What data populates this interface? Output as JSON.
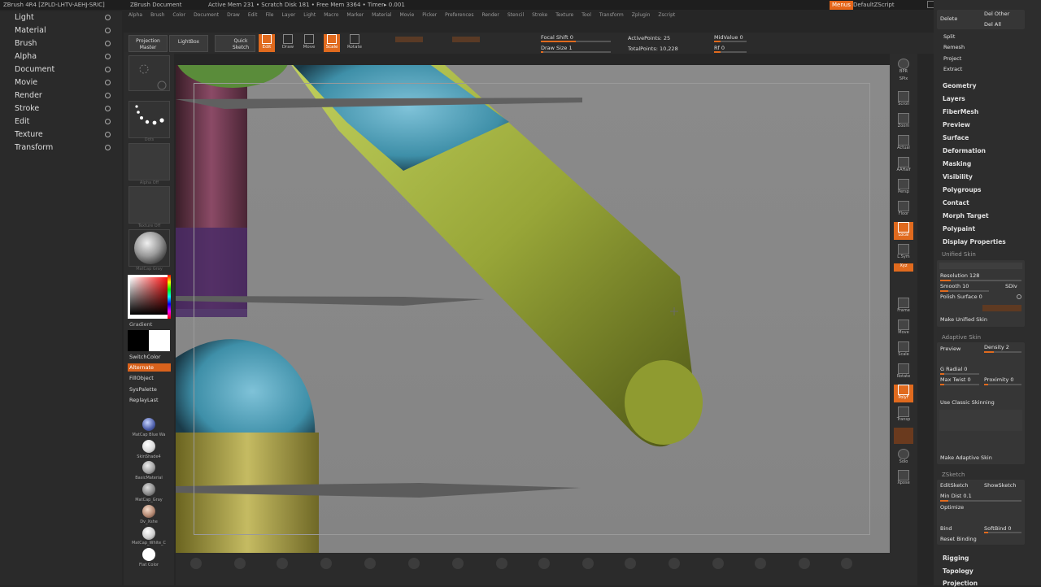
{
  "title_bar": {
    "app": "ZBrush 4R4 [ZPLD-LHTV-AEHJ-SRIC]",
    "document": "ZBrush Document",
    "stats": "Active Mem 231 • Scratch Disk 181 • Free Mem 3364 • Timer▸ 0.001",
    "menus_button": "Menus",
    "script_label": "DefaultZScript"
  },
  "menubar": [
    "Alpha",
    "Brush",
    "Color",
    "Document",
    "Draw",
    "Edit",
    "File",
    "Layer",
    "Light",
    "Macro",
    "Marker",
    "Material",
    "Movie",
    "Picker",
    "Preferences",
    "Render",
    "Stencil",
    "Stroke",
    "Texture",
    "Tool",
    "Transform",
    "Zplugin",
    "Zscript"
  ],
  "left_menu": [
    "Light",
    "Material",
    "Brush",
    "Alpha",
    "Document",
    "Movie",
    "Render",
    "Stroke",
    "Edit",
    "Texture",
    "Transform"
  ],
  "shelf": {
    "labels": [
      "Dots",
      "Alpha Off",
      "Texture Off",
      "MatCap Gray"
    ],
    "gradient": "Gradient",
    "buttons": [
      "SwitchColor",
      "Alternate",
      "FillObject",
      "SysPalette",
      "ReplayLast"
    ],
    "materials": [
      "MatCap Blue Wa",
      "SkinShade4",
      "BasicMaterial",
      "MatCap_Gray",
      "Dv_Xshe",
      "MatCap_White_C",
      "Flat Color"
    ]
  },
  "toolbar": {
    "projection_master": "Projection Master",
    "lightbox": "LightBox",
    "quick_sketch": "Quick Sketch",
    "edit": "Edit",
    "draw": "Draw",
    "move": "Move",
    "scale": "Scale",
    "rotate": "Rotate",
    "focal_shift": "Focal Shift 0",
    "draw_size": "Draw Size 1",
    "active_points": "ActivePoints: 25",
    "total_points": "TotalPoints: 10,228",
    "mid_value": "MidValue 0",
    "rf": "Rf 0"
  },
  "right_shelf": [
    "BPR",
    "SPix",
    "Scroll",
    "Zoom",
    "Actual",
    "AAHalf",
    "Persp",
    "Floor",
    "Local",
    "L.Sym",
    "Xyz",
    "Frame",
    "Move",
    "Scale",
    "Rotate",
    "PolyF",
    "Transp",
    "Solo",
    "Xpose"
  ],
  "tray": {
    "delete": "Delete",
    "del_other": "Del Other",
    "del_all": "Del All",
    "top_links": [
      "Split",
      "Remesh",
      "Project",
      "Extract"
    ],
    "sections": [
      "Geometry",
      "Layers",
      "FiberMesh",
      "Preview",
      "Surface",
      "Deformation",
      "Masking",
      "Visibility",
      "Polygroups",
      "Contact",
      "Morph Target",
      "Polypaint",
      "Display Properties"
    ],
    "unified_skin": {
      "title": "Unified Skin",
      "resolution": "Resolution 128",
      "smooth": "Smooth 10",
      "sdiv": "SDiv",
      "polish": "Polish Surface 0",
      "make": "Make Unified Skin"
    },
    "adaptive_skin": {
      "title": "Adaptive Skin",
      "preview": "Preview",
      "density": "Density 2",
      "g_radial": "G Radial 0",
      "max_twist": "Max Twist 0",
      "proximity": "Proximity 0",
      "classic": "Use Classic Skinning",
      "make": "Make Adaptive Skin"
    },
    "zsketch": {
      "title": "ZSketch",
      "edit": "EditSketch",
      "show": "ShowSketch",
      "min_dist": "Min Dist 0.1",
      "optimize": "Optimize",
      "bind": "Bind",
      "soft_bind": "SoftBind 0",
      "reset": "Reset Binding"
    },
    "bottom_links": [
      "Rigging",
      "Topology",
      "Projection"
    ]
  }
}
